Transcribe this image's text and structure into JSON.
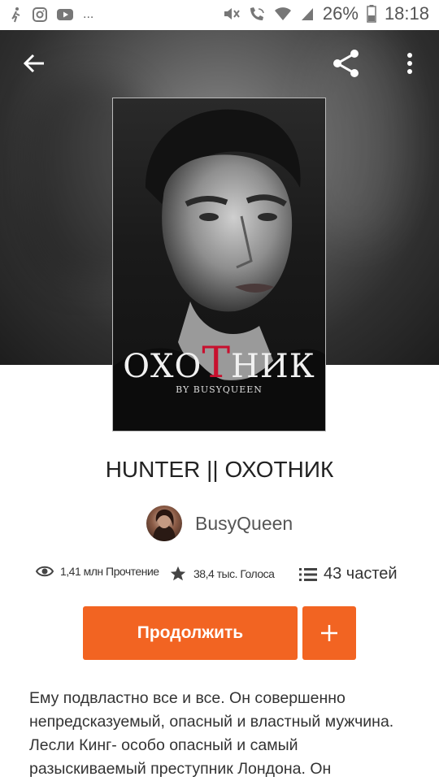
{
  "status_bar": {
    "battery": "26%",
    "time": "18:18",
    "left_icons": [
      "walking-person-icon",
      "instagram-icon",
      "youtube-icon",
      "more-dots-icon"
    ],
    "right_icons": [
      "mute-icon",
      "wifi-call-icon",
      "wifi-icon",
      "signal-icon",
      "battery-icon"
    ],
    "more_glyph": "..."
  },
  "toolbar": {
    "back_icon": "arrow-left-icon",
    "share_icon": "share-icon",
    "more_icon": "vertical-dots-icon"
  },
  "cover": {
    "title_part1": "ОХО",
    "title_red": "Т",
    "title_part2": "НИК",
    "byline": "BY BUSYQUEEN"
  },
  "book": {
    "title": "HUNTER || ОХОТНИК",
    "author": "BusyQueen"
  },
  "stats": {
    "reads": "1,41 млн Прочтение",
    "votes": "38,4 тыс. Голоса",
    "parts": "43 частей"
  },
  "actions": {
    "continue_label": "Продолжить",
    "add_label": "+"
  },
  "description": "Ему подвластно все и все. Он совершенно непредсказуемый, опасный и властный мужчина. Лесли Кинг- особо опасный и самый разыскиваемый преступник Лондона. Он",
  "colors": {
    "accent": "#f26422",
    "cover_title_red": "#c8102e"
  }
}
